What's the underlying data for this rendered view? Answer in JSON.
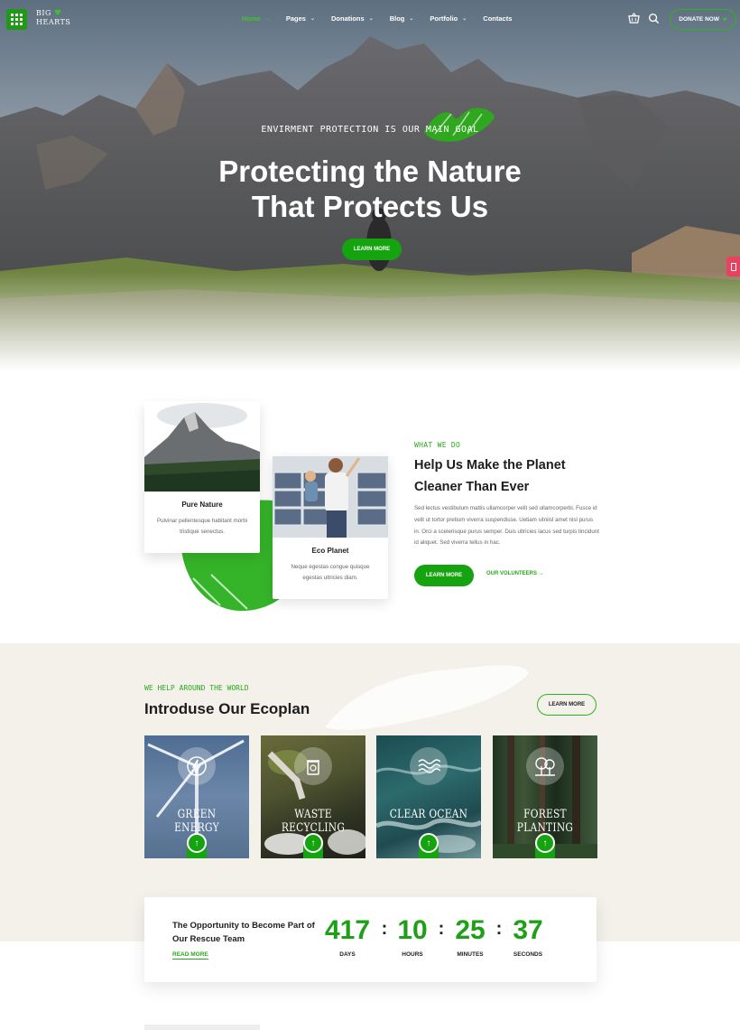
{
  "brand": {
    "logo_line1": "BIG",
    "logo_line2": "HEARTS"
  },
  "nav": {
    "items": [
      {
        "label": "Home",
        "active": true,
        "has_dropdown": true
      },
      {
        "label": "Pages",
        "has_dropdown": true
      },
      {
        "label": "Donations",
        "has_dropdown": true
      },
      {
        "label": "Blog",
        "has_dropdown": true
      },
      {
        "label": "Portfolio",
        "has_dropdown": true
      },
      {
        "label": "Contacts",
        "has_dropdown": false
      }
    ],
    "donate_label": "DONATE NOW",
    "icons": [
      "menu-grid-icon",
      "cart-icon",
      "search-icon",
      "heart-icon"
    ]
  },
  "hero": {
    "kicker": "Envirment protection is our main goal",
    "title_line1": "Protecting the Nature",
    "title_line2": "That Protects Us",
    "button": "LEARN MORE"
  },
  "what_we_do": {
    "kicker": "WHAT WE DO",
    "title": "Help Us Make the Planet Cleaner Than Ever",
    "body": "Sed lectus vestibulum mattis ullamcorper velit sed ullamcorperbi. Fusce id velit ut tortor pretium viverra suspendisse. Uetiam sitniisl amet nisl purus in. Orci a scelerisque purus semper. Duis ultricies lacus sed turpis tincidunt id aliquet. Sed viverra tellus in hac.",
    "button": "LEARN MORE",
    "link": "OUR VOLUNTEERS",
    "cards": [
      {
        "title": "Pure Nature",
        "text": "Pulvinar pellentesque habitant morbi tristique senectus."
      },
      {
        "title": "Eco Planet",
        "text": "Neque egestas congue quisque egestas ultricies diam."
      }
    ]
  },
  "ecoplan": {
    "kicker": "WE HELP AROUND THE WORLD",
    "title": "Introduse Our Ecoplan",
    "button": "LEARN MORE",
    "tiles": [
      {
        "label": "Green Energy",
        "icon": "lightning-icon"
      },
      {
        "label": "Waste Recycling",
        "icon": "trash-bin-icon"
      },
      {
        "label": "Clear Ocean",
        "icon": "waves-icon"
      },
      {
        "label": "Forest Planting",
        "icon": "trees-icon"
      }
    ]
  },
  "countdown": {
    "text": "The Opportunity to Become Part of Our Rescue Team",
    "link": "READ MORE",
    "days": "417",
    "days_label": "DAYS",
    "hours": "10",
    "hours_label": "HOURS",
    "minutes": "25",
    "minutes_label": "MINUTES",
    "seconds": "37",
    "seconds_label": "SECONDS",
    "separator": ":"
  },
  "colors": {
    "accent": "#15a30f",
    "accent_light": "#37c22a",
    "cream": "#f4f1eb",
    "side_tab": "#e54360"
  }
}
